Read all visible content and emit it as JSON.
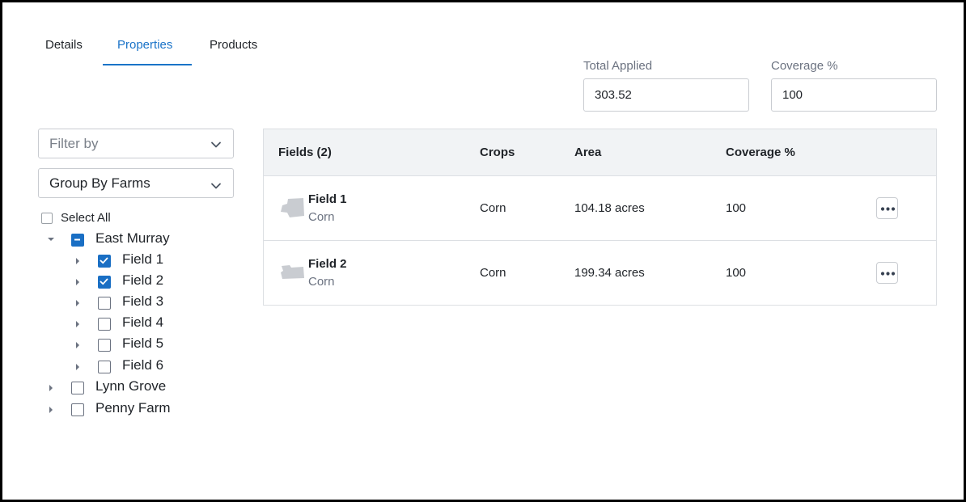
{
  "tabs": [
    {
      "label": "Details"
    },
    {
      "label": "Properties",
      "active": true
    },
    {
      "label": "Products"
    }
  ],
  "totals": {
    "total_applied_label": "Total Applied",
    "total_applied_value": "303.52",
    "coverage_label": "Coverage %",
    "coverage_value": "100"
  },
  "filters": {
    "filter_placeholder": "Filter by",
    "group_by_value": "Group By Farms"
  },
  "tree": {
    "select_all_label": "Select All",
    "farms": [
      {
        "label": "East Murray",
        "state": "partial",
        "expanded": true,
        "fields": [
          {
            "label": "Field 1",
            "checked": true
          },
          {
            "label": "Field 2",
            "checked": true
          },
          {
            "label": "Field 3",
            "checked": false
          },
          {
            "label": "Field 4",
            "checked": false
          },
          {
            "label": "Field 5",
            "checked": false
          },
          {
            "label": "Field 6",
            "checked": false
          }
        ]
      },
      {
        "label": "Lynn Grove",
        "state": "unchecked",
        "expanded": false
      },
      {
        "label": "Penny Farm",
        "state": "unchecked",
        "expanded": false
      }
    ]
  },
  "table": {
    "headers": {
      "fields": "Fields (2)",
      "crops": "Crops",
      "area": "Area",
      "coverage": "Coverage %"
    },
    "rows": [
      {
        "name": "Field 1",
        "sub_crop": "Corn",
        "crops": "Corn",
        "area": "104.18 acres",
        "coverage": "100"
      },
      {
        "name": "Field 2",
        "sub_crop": "Corn",
        "crops": "Corn",
        "area": "199.34 acres",
        "coverage": "100"
      }
    ]
  },
  "colors": {
    "accent": "#1a73c8",
    "checkbox": "#1a6fc4",
    "header_bg": "#f1f3f5",
    "field_shape": "#c9ccd1"
  },
  "icons": {
    "dropdown": "chevron-down-icon",
    "expand": "caret-right-icon",
    "collapse": "caret-down-icon",
    "more": "more-horizontal-icon",
    "field_shape": "field-boundary-icon"
  }
}
